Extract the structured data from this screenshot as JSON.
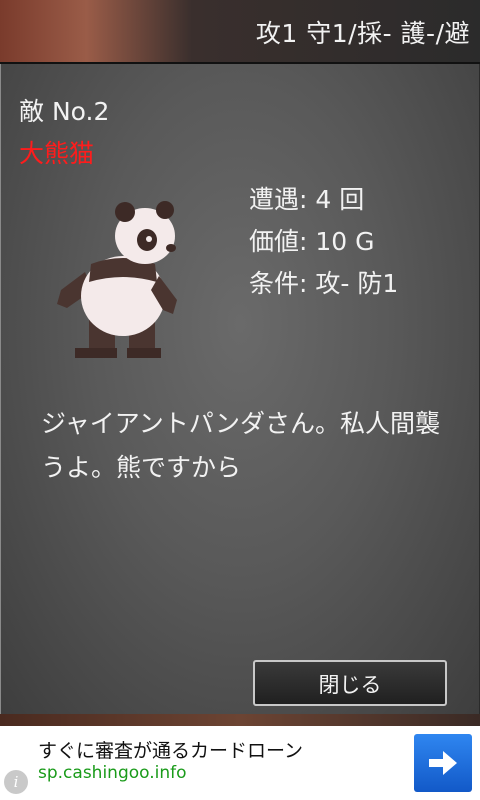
{
  "header": {
    "stats": "攻1 守1/採- 護-/避"
  },
  "enemy": {
    "number_label": "敵 No.2",
    "name": "大熊猫",
    "encounters": "遭遇: 4 回",
    "value": "価値: 10 G",
    "condition": "条件: 攻- 防1",
    "description": "ジャイアントパンダさん。私人間襲うよ。熊ですから"
  },
  "dialog": {
    "close_label": "閉じる"
  },
  "ad": {
    "title": "すぐに審査が通るカードローン",
    "url": "sp.cashingoo.info",
    "info_icon_glyph": "i"
  },
  "colors": {
    "enemy_name": "#ff1c1c",
    "ad_url": "#1a9b1a",
    "ad_button": "#1e6fdc"
  },
  "icons": [
    "panda-sprite",
    "arrow-right-icon",
    "info-icon"
  ]
}
